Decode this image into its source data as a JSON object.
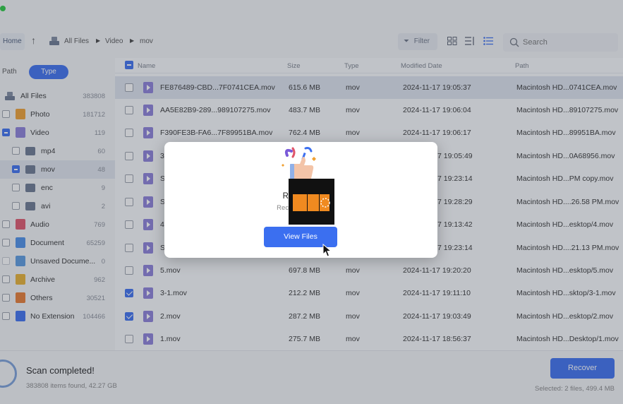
{
  "toolbar": {
    "home": "Home",
    "breadcrumb": [
      "All Files",
      "Video",
      "mov"
    ],
    "filter": "Filter",
    "search_placeholder": "Search"
  },
  "sidebar": {
    "tab_path": "Path",
    "tab_type": "Type",
    "items": [
      {
        "label": "All Files",
        "count": "383808",
        "icon": "drive-icon"
      },
      {
        "label": "Photo",
        "count": "181712",
        "icon": "photo-icon"
      },
      {
        "label": "Video",
        "count": "119",
        "icon": "video-icon"
      },
      {
        "label": "mp4",
        "count": "60",
        "icon": "folder-icon"
      },
      {
        "label": "mov",
        "count": "48",
        "icon": "folder-icon"
      },
      {
        "label": "enc",
        "count": "9",
        "icon": "folder-icon"
      },
      {
        "label": "avi",
        "count": "2",
        "icon": "folder-icon"
      },
      {
        "label": "Audio",
        "count": "769",
        "icon": "audio-icon"
      },
      {
        "label": "Document",
        "count": "65259",
        "icon": "document-icon"
      },
      {
        "label": "Unsaved Docume...",
        "count": "0",
        "icon": "unsaved-document-icon"
      },
      {
        "label": "Archive",
        "count": "962",
        "icon": "archive-icon"
      },
      {
        "label": "Others",
        "count": "30521",
        "icon": "others-icon"
      },
      {
        "label": "No Extension",
        "count": "104466",
        "icon": "no-extension-icon"
      }
    ]
  },
  "table": {
    "columns": [
      "Name",
      "Size",
      "Type",
      "Modified Date",
      "Path"
    ],
    "rows": [
      {
        "name": "FE876489-CBD...7F0741CEA.mov",
        "size": "615.6 MB",
        "type": "mov",
        "date": "2024-11-17 19:05:37",
        "path": "Macintosh HD...0741CEA.mov"
      },
      {
        "name": "AA5E82B9-289...989107275.mov",
        "size": "483.7 MB",
        "type": "mov",
        "date": "2024-11-17 19:06:04",
        "path": "Macintosh HD...89107275.mov"
      },
      {
        "name": "F390FE3B-FA6...7F89951BA.mov",
        "size": "762.4 MB",
        "type": "mov",
        "date": "2024-11-17 19:06:17",
        "path": "Macintosh HD...89951BA.mov"
      },
      {
        "name": "3",
        "size": "",
        "type": "",
        "date": "7 19:05:49",
        "path": "Macintosh HD...0A68956.mov"
      },
      {
        "name": "S",
        "size": "",
        "type": "",
        "date": "7 19:23:14",
        "path": "Macintosh HD...PM copy.mov"
      },
      {
        "name": "S",
        "size": "",
        "type": "",
        "date": "7 19:28:29",
        "path": "Macintosh HD....26.58 PM.mov"
      },
      {
        "name": "4",
        "size": "",
        "type": "",
        "date": "7 19:13:42",
        "path": "Macintosh HD...esktop/4.mov"
      },
      {
        "name": "S",
        "size": "",
        "type": "",
        "date": "7 19:23:14",
        "path": "Macintosh HD....21.13 PM.mov"
      },
      {
        "name": "5.mov",
        "size": "697.8 MB",
        "type": "mov",
        "date": "2024-11-17 19:20:20",
        "path": "Macintosh HD...esktop/5.mov"
      },
      {
        "name": "3-1.mov",
        "size": "212.2 MB",
        "type": "mov",
        "date": "2024-11-17 19:11:10",
        "path": "Macintosh HD...sktop/3-1.mov"
      },
      {
        "name": "2.mov",
        "size": "287.2 MB",
        "type": "mov",
        "date": "2024-11-17 19:03:49",
        "path": "Macintosh HD...esktop/2.mov"
      },
      {
        "name": "1.mov",
        "size": "275.7 MB",
        "type": "mov",
        "date": "2024-11-17 18:56:37",
        "path": "Macintosh HD...Desktop/1.mov"
      }
    ]
  },
  "bottom": {
    "scan_title": "Scan completed!",
    "scan_sub": "383808 items found, 42.27 GB",
    "recover": "Recover",
    "selected": "Selected: 2 files, 499.4 MB"
  },
  "modal": {
    "title": "Recove                d!",
    "sub": "Recovered:                MB)",
    "button": "View Files"
  },
  "colors": {
    "accent": "#3b6ff0"
  }
}
